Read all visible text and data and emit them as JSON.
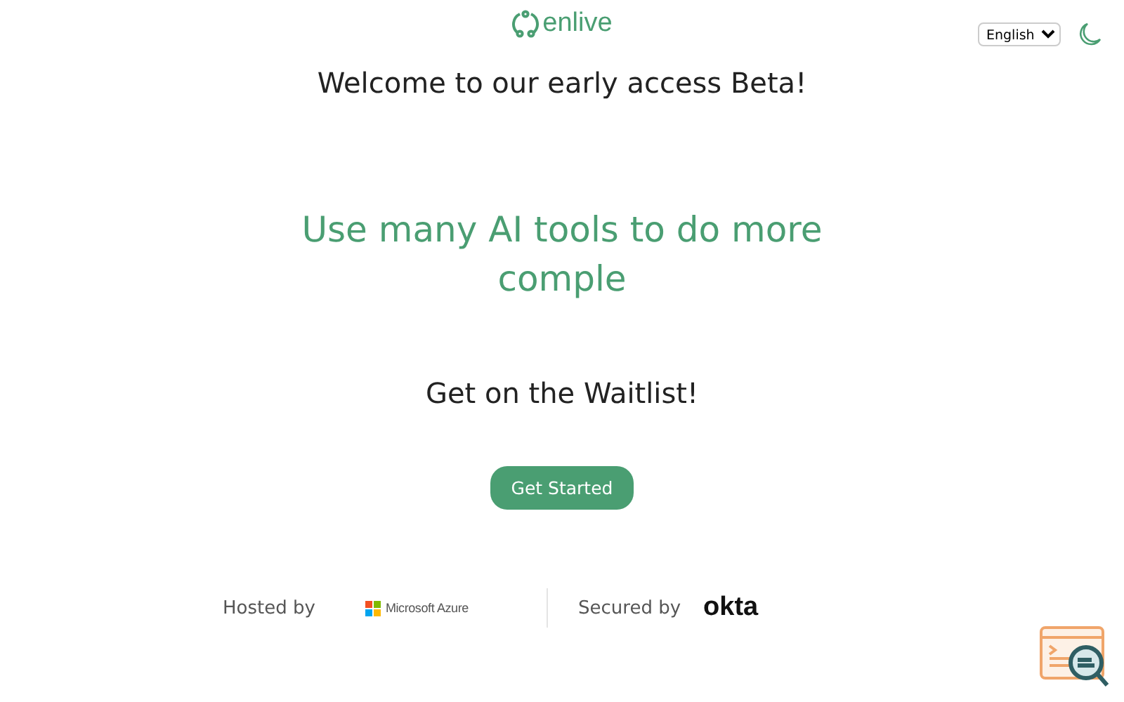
{
  "header": {
    "logo": "enlive",
    "language": "English"
  },
  "welcome": "Welcome to our early access Beta!",
  "tagline": "Use many AI tools to do more comple",
  "waitlist": "Get on the Waitlist!",
  "cta": "Get Started",
  "footer": {
    "hosted_label": "Hosted by",
    "host_logo": "Microsoft Azure",
    "secured_label": "Secured by",
    "security_logo": "okta"
  }
}
